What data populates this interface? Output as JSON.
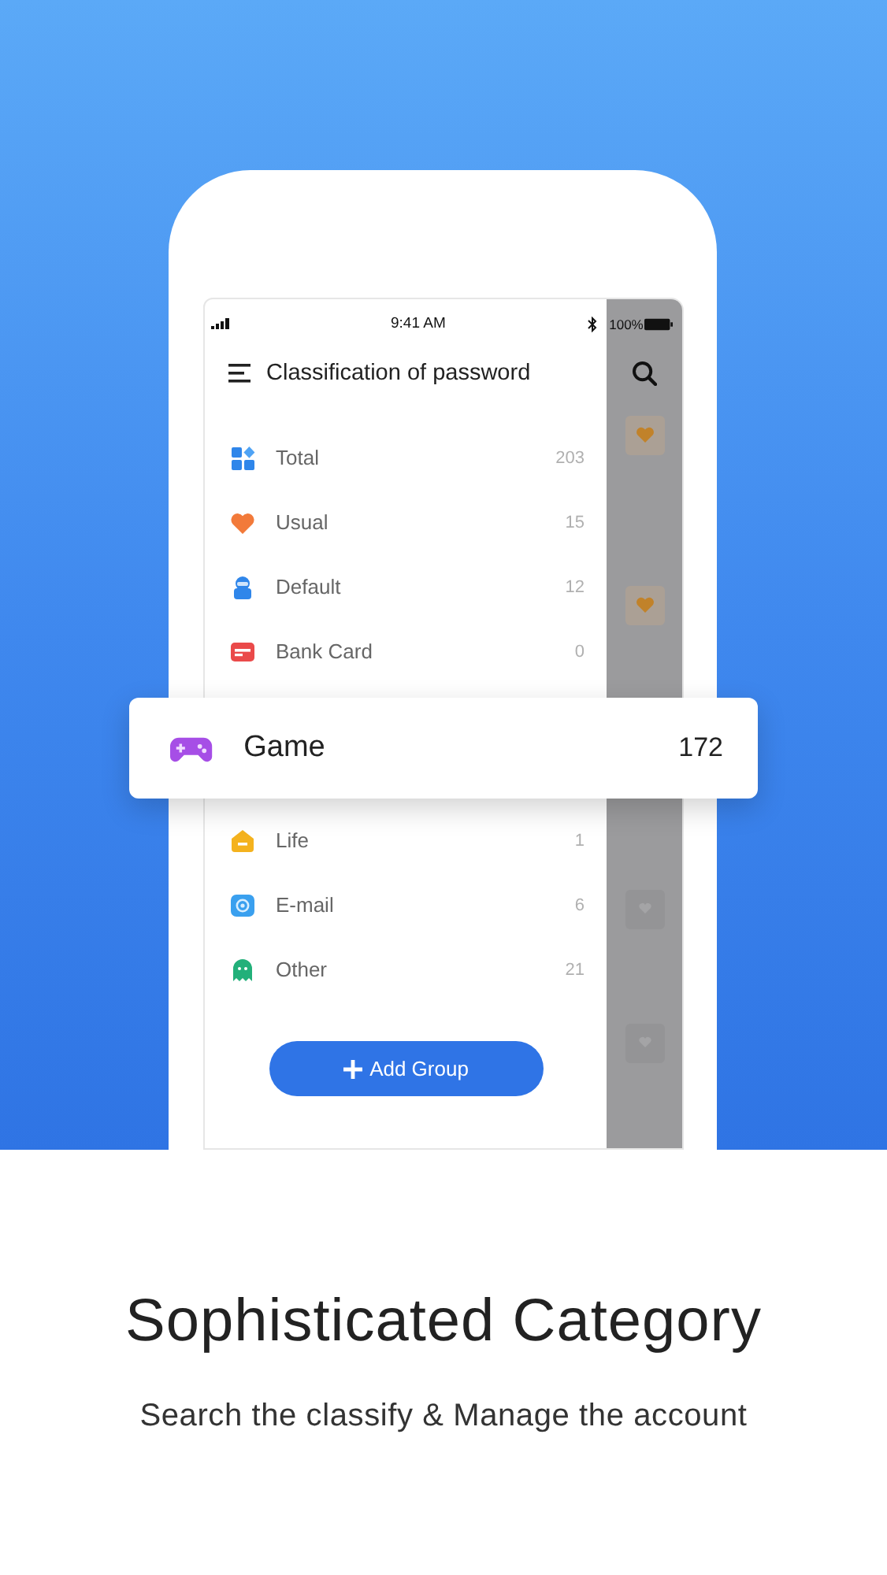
{
  "status_bar": {
    "time": "9:41 AM",
    "battery": "100%"
  },
  "header": {
    "title": "Classification of password"
  },
  "categories": [
    {
      "name": "Total",
      "count": "203",
      "highlighted": false
    },
    {
      "name": "Usual",
      "count": "15",
      "highlighted": false
    },
    {
      "name": "Default",
      "count": "12",
      "highlighted": false
    },
    {
      "name": "Bank Card",
      "count": "0",
      "highlighted": false
    },
    {
      "name": "Game",
      "count": "172",
      "highlighted": true
    },
    {
      "name": "Life",
      "count": "1",
      "highlighted": false
    },
    {
      "name": "E-mail",
      "count": "6",
      "highlighted": false
    },
    {
      "name": "Other",
      "count": "21",
      "highlighted": false
    }
  ],
  "add_button": {
    "label": "Add Group"
  },
  "caption": {
    "title": "Sophisticated Category",
    "subtitle": "Search the classify & Manage the account"
  }
}
